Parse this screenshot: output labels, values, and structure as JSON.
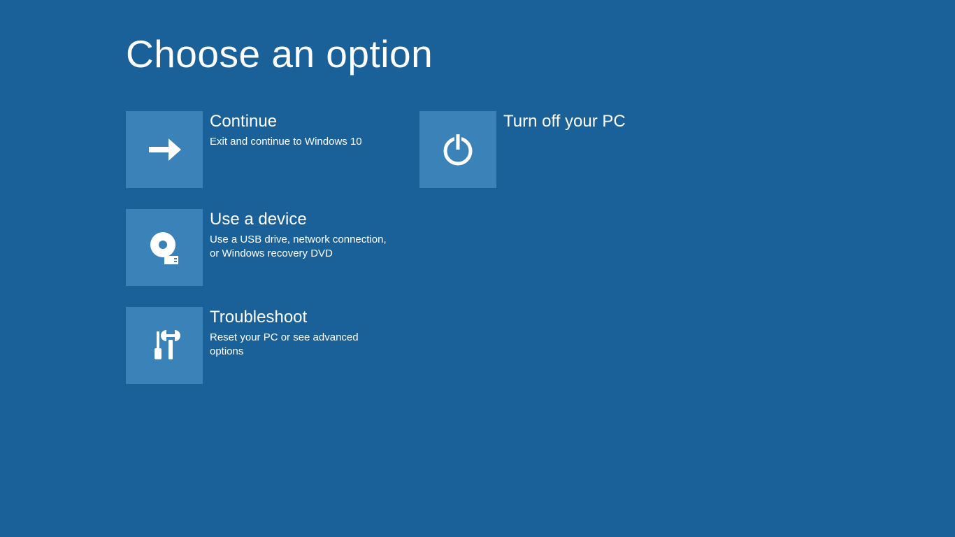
{
  "title": "Choose an option",
  "options": [
    {
      "label": "Continue",
      "description": "Exit and continue to Windows 10"
    },
    {
      "label": "Turn off your PC",
      "description": ""
    },
    {
      "label": "Use a device",
      "description": "Use a USB drive, network connection, or Windows recovery DVD"
    },
    {
      "label": "Troubleshoot",
      "description": "Reset your PC or see advanced options"
    }
  ]
}
